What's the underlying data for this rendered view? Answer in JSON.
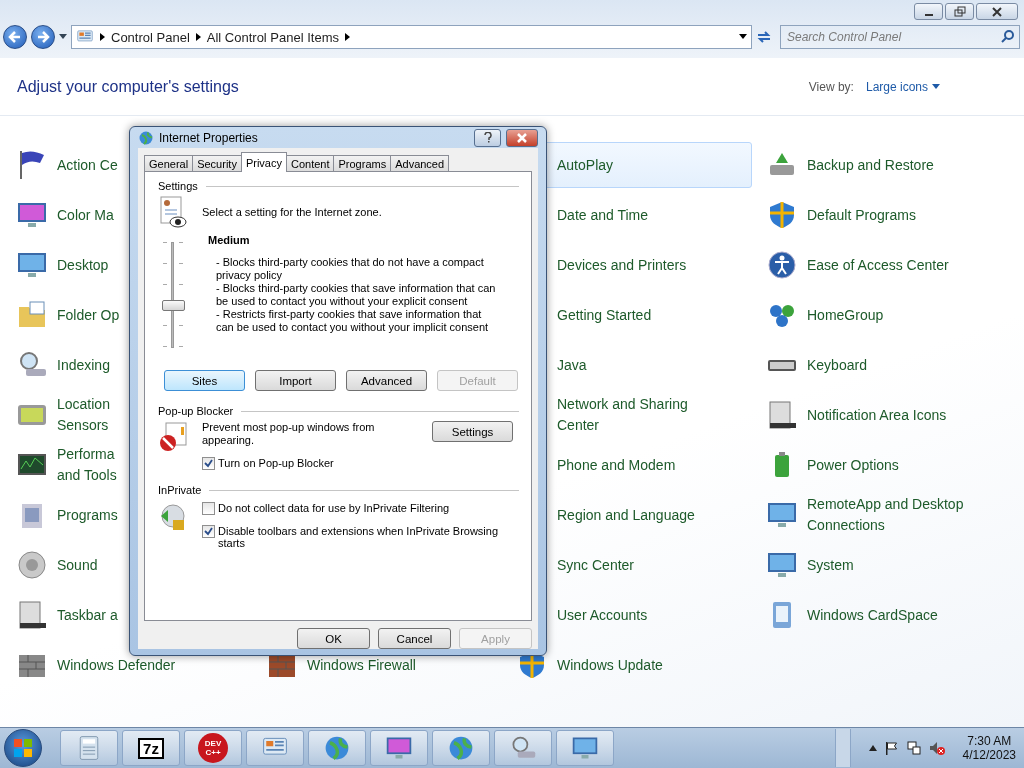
{
  "address_bar": {
    "crumbs": [
      "Control Panel",
      "All Control Panel Items"
    ]
  },
  "search": {
    "placeholder": "Search Control Panel"
  },
  "header": {
    "title": "Adjust your computer's settings",
    "view_by_label": "View by:",
    "view_by_value": "Large icons"
  },
  "columns": [
    [
      {
        "label": "Action Ce",
        "highlighted": false
      },
      {
        "label": "Color Ma",
        "highlighted": false
      },
      {
        "label": "Desktop",
        "highlighted": false
      },
      {
        "label": "Folder Op",
        "highlighted": false
      },
      {
        "label": "Indexing",
        "highlighted": false
      },
      {
        "label": "Location\nSensors",
        "highlighted": false
      },
      {
        "label": "Performa\nand Tools",
        "highlighted": false
      },
      {
        "label": "Programs",
        "highlighted": false
      },
      {
        "label": "Sound",
        "highlighted": false
      },
      {
        "label": "Taskbar a",
        "highlighted": false
      },
      {
        "label": "Windows Defender",
        "highlighted": false
      }
    ],
    [
      {
        "label": "Windows Firewall",
        "highlighted": false
      }
    ],
    [
      {
        "label": "AutoPlay",
        "highlighted": true
      },
      {
        "label": "Date and Time",
        "highlighted": false
      },
      {
        "label": "Devices and Printers",
        "highlighted": false
      },
      {
        "label": "Getting Started",
        "highlighted": false
      },
      {
        "label": "Java",
        "highlighted": false
      },
      {
        "label": "Network and Sharing Center",
        "highlighted": false
      },
      {
        "label": "Phone and Modem",
        "highlighted": false
      },
      {
        "label": "Region and Language",
        "highlighted": false
      },
      {
        "label": "Sync Center",
        "highlighted": false
      },
      {
        "label": "User Accounts",
        "highlighted": false
      },
      {
        "label": "Windows Update",
        "highlighted": false
      }
    ],
    [
      {
        "label": "Backup and Restore",
        "highlighted": false
      },
      {
        "label": "Default Programs",
        "highlighted": false
      },
      {
        "label": "Ease of Access Center",
        "highlighted": false
      },
      {
        "label": "HomeGroup",
        "highlighted": false
      },
      {
        "label": "Keyboard",
        "highlighted": false
      },
      {
        "label": "Notification Area Icons",
        "highlighted": false
      },
      {
        "label": "Power Options",
        "highlighted": false
      },
      {
        "label": "RemoteApp and Desktop Connections",
        "highlighted": false
      },
      {
        "label": "System",
        "highlighted": false
      },
      {
        "label": "Windows CardSpace",
        "highlighted": false
      }
    ]
  ],
  "dialog": {
    "title": "Internet Properties",
    "tabs": [
      {
        "label": "General",
        "selected": false
      },
      {
        "label": "Security",
        "selected": false
      },
      {
        "label": "Privacy",
        "selected": true
      },
      {
        "label": "Content",
        "selected": false
      },
      {
        "label": "Programs",
        "selected": false
      },
      {
        "label": "Advanced",
        "selected": false
      }
    ],
    "settings": {
      "heading": "Settings",
      "intro": "Select a setting for the Internet zone.",
      "slider": {
        "level": 0.4
      },
      "level_name": "Medium",
      "description": [
        "- Blocks third-party cookies that do not have a compact privacy policy",
        "- Blocks third-party cookies that save information that can be used to contact you without your explicit consent",
        "- Restricts first-party cookies that save information that can be used to contact you without your implicit consent"
      ],
      "buttons": [
        {
          "label": "Sites",
          "disabled": false,
          "focused": true
        },
        {
          "label": "Import",
          "disabled": false,
          "focused": false
        },
        {
          "label": "Advanced",
          "disabled": false,
          "focused": false
        },
        {
          "label": "Default",
          "disabled": true,
          "focused": false
        }
      ]
    },
    "popup": {
      "heading": "Pop-up Blocker",
      "text": "Prevent most pop-up windows from appearing.",
      "button": "Settings",
      "checkbox": {
        "label": "Turn on Pop-up Blocker",
        "checked": true
      }
    },
    "inprivate": {
      "heading": "InPrivate",
      "checkboxes": [
        {
          "label": "Do not collect data for use by InPrivate Filtering",
          "checked": false
        },
        {
          "label": "Disable toolbars and extensions when InPrivate Browsing starts",
          "checked": true
        }
      ]
    },
    "footer": [
      {
        "label": "OK",
        "disabled": false
      },
      {
        "label": "Cancel",
        "disabled": false
      },
      {
        "label": "Apply",
        "disabled": true
      }
    ]
  },
  "taskbar": {
    "apps": [
      {
        "kind": "calculator"
      },
      {
        "kind": "sevenzip",
        "label": "7z"
      },
      {
        "kind": "devcpp",
        "label": "DEV C++"
      },
      {
        "kind": "panel"
      },
      {
        "kind": "globe-clock"
      },
      {
        "kind": "color-monitor"
      },
      {
        "kind": "globe-check"
      },
      {
        "kind": "magnifier"
      },
      {
        "kind": "monitor"
      }
    ],
    "clock": {
      "time": "7:30 AM",
      "date": "4/12/2023"
    }
  }
}
